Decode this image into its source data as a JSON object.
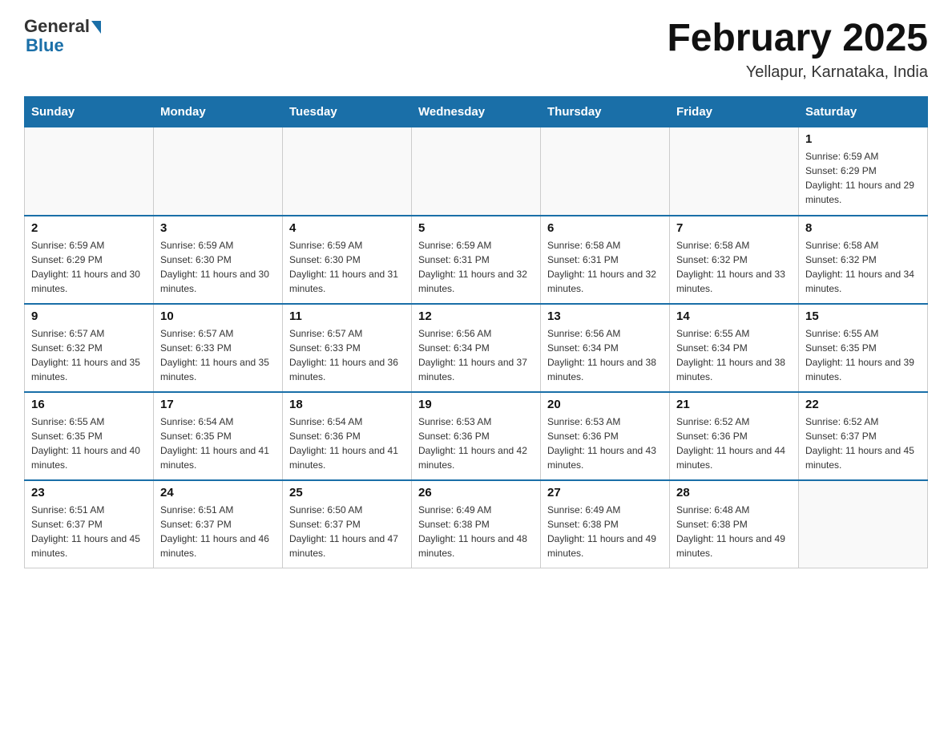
{
  "header": {
    "logo_general": "General",
    "logo_blue": "Blue",
    "title": "February 2025",
    "location": "Yellapur, Karnataka, India"
  },
  "days_of_week": [
    "Sunday",
    "Monday",
    "Tuesday",
    "Wednesday",
    "Thursday",
    "Friday",
    "Saturday"
  ],
  "weeks": [
    [
      {
        "day": "",
        "info": ""
      },
      {
        "day": "",
        "info": ""
      },
      {
        "day": "",
        "info": ""
      },
      {
        "day": "",
        "info": ""
      },
      {
        "day": "",
        "info": ""
      },
      {
        "day": "",
        "info": ""
      },
      {
        "day": "1",
        "info": "Sunrise: 6:59 AM\nSunset: 6:29 PM\nDaylight: 11 hours and 29 minutes."
      }
    ],
    [
      {
        "day": "2",
        "info": "Sunrise: 6:59 AM\nSunset: 6:29 PM\nDaylight: 11 hours and 30 minutes."
      },
      {
        "day": "3",
        "info": "Sunrise: 6:59 AM\nSunset: 6:30 PM\nDaylight: 11 hours and 30 minutes."
      },
      {
        "day": "4",
        "info": "Sunrise: 6:59 AM\nSunset: 6:30 PM\nDaylight: 11 hours and 31 minutes."
      },
      {
        "day": "5",
        "info": "Sunrise: 6:59 AM\nSunset: 6:31 PM\nDaylight: 11 hours and 32 minutes."
      },
      {
        "day": "6",
        "info": "Sunrise: 6:58 AM\nSunset: 6:31 PM\nDaylight: 11 hours and 32 minutes."
      },
      {
        "day": "7",
        "info": "Sunrise: 6:58 AM\nSunset: 6:32 PM\nDaylight: 11 hours and 33 minutes."
      },
      {
        "day": "8",
        "info": "Sunrise: 6:58 AM\nSunset: 6:32 PM\nDaylight: 11 hours and 34 minutes."
      }
    ],
    [
      {
        "day": "9",
        "info": "Sunrise: 6:57 AM\nSunset: 6:32 PM\nDaylight: 11 hours and 35 minutes."
      },
      {
        "day": "10",
        "info": "Sunrise: 6:57 AM\nSunset: 6:33 PM\nDaylight: 11 hours and 35 minutes."
      },
      {
        "day": "11",
        "info": "Sunrise: 6:57 AM\nSunset: 6:33 PM\nDaylight: 11 hours and 36 minutes."
      },
      {
        "day": "12",
        "info": "Sunrise: 6:56 AM\nSunset: 6:34 PM\nDaylight: 11 hours and 37 minutes."
      },
      {
        "day": "13",
        "info": "Sunrise: 6:56 AM\nSunset: 6:34 PM\nDaylight: 11 hours and 38 minutes."
      },
      {
        "day": "14",
        "info": "Sunrise: 6:55 AM\nSunset: 6:34 PM\nDaylight: 11 hours and 38 minutes."
      },
      {
        "day": "15",
        "info": "Sunrise: 6:55 AM\nSunset: 6:35 PM\nDaylight: 11 hours and 39 minutes."
      }
    ],
    [
      {
        "day": "16",
        "info": "Sunrise: 6:55 AM\nSunset: 6:35 PM\nDaylight: 11 hours and 40 minutes."
      },
      {
        "day": "17",
        "info": "Sunrise: 6:54 AM\nSunset: 6:35 PM\nDaylight: 11 hours and 41 minutes."
      },
      {
        "day": "18",
        "info": "Sunrise: 6:54 AM\nSunset: 6:36 PM\nDaylight: 11 hours and 41 minutes."
      },
      {
        "day": "19",
        "info": "Sunrise: 6:53 AM\nSunset: 6:36 PM\nDaylight: 11 hours and 42 minutes."
      },
      {
        "day": "20",
        "info": "Sunrise: 6:53 AM\nSunset: 6:36 PM\nDaylight: 11 hours and 43 minutes."
      },
      {
        "day": "21",
        "info": "Sunrise: 6:52 AM\nSunset: 6:36 PM\nDaylight: 11 hours and 44 minutes."
      },
      {
        "day": "22",
        "info": "Sunrise: 6:52 AM\nSunset: 6:37 PM\nDaylight: 11 hours and 45 minutes."
      }
    ],
    [
      {
        "day": "23",
        "info": "Sunrise: 6:51 AM\nSunset: 6:37 PM\nDaylight: 11 hours and 45 minutes."
      },
      {
        "day": "24",
        "info": "Sunrise: 6:51 AM\nSunset: 6:37 PM\nDaylight: 11 hours and 46 minutes."
      },
      {
        "day": "25",
        "info": "Sunrise: 6:50 AM\nSunset: 6:37 PM\nDaylight: 11 hours and 47 minutes."
      },
      {
        "day": "26",
        "info": "Sunrise: 6:49 AM\nSunset: 6:38 PM\nDaylight: 11 hours and 48 minutes."
      },
      {
        "day": "27",
        "info": "Sunrise: 6:49 AM\nSunset: 6:38 PM\nDaylight: 11 hours and 49 minutes."
      },
      {
        "day": "28",
        "info": "Sunrise: 6:48 AM\nSunset: 6:38 PM\nDaylight: 11 hours and 49 minutes."
      },
      {
        "day": "",
        "info": ""
      }
    ]
  ]
}
